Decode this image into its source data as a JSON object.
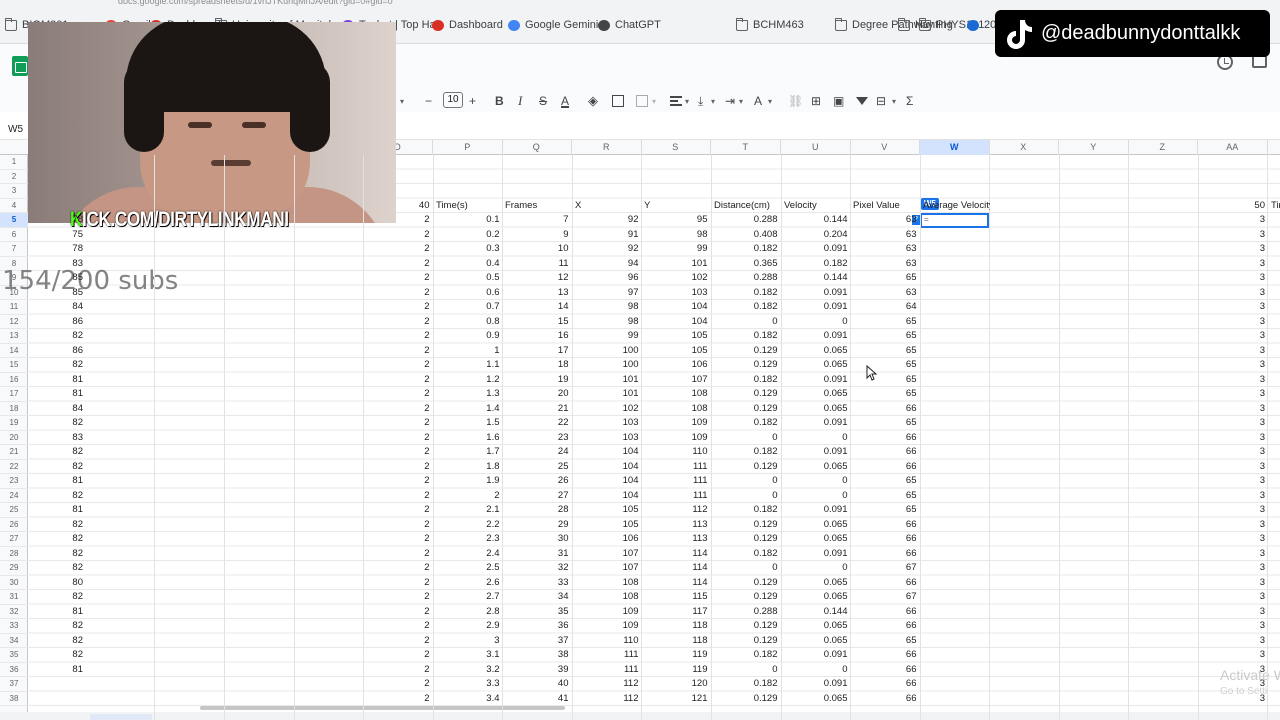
{
  "browser": {
    "bookmarks": [
      {
        "label": "BIOM301",
        "icon": "folder-icon"
      },
      {
        "label": "Gmail",
        "icon": "gmail-icon"
      },
      {
        "label": "Dashboard",
        "icon": "dashboard-icon"
      },
      {
        "label": "University of Manitoba",
        "icon": "folder-icon"
      },
      {
        "label": "Tophat | Top Hat",
        "icon": "tophat-icon"
      },
      {
        "label": "Dashboard",
        "icon": "dashboard-icon"
      },
      {
        "label": "Google Gemini",
        "icon": "gemini-icon"
      },
      {
        "label": "ChatGPT",
        "icon": "chatgpt-icon"
      },
      {
        "label": "BCHM463",
        "icon": "folder-icon"
      },
      {
        "label": "Degree Pathway",
        "icon": "folder-icon"
      },
      {
        "label": "Hunting",
        "icon": "folder-icon"
      },
      {
        "label": "PHYS131",
        "icon": "folder-icon"
      },
      {
        "label": "20",
        "icon": "bmw-icon"
      }
    ],
    "url": "docs.google.com/spreadsheets/d/1vhJTKuhqMhJA/edit?gid=0#gid=0"
  },
  "sheet": {
    "name_box": "W5",
    "font_size": "10",
    "toolbar_icons": [
      "minus-icon",
      "plus-icon",
      "bold-icon",
      "italic-icon",
      "strikethrough-icon",
      "text-color-icon",
      "fill-color-icon",
      "borders-icon",
      "merge-icon",
      "align-icon",
      "valign-icon",
      "wrap-icon",
      "rotate-icon",
      "link-icon",
      "comment-icon",
      "chart-icon",
      "filter-icon",
      "views-icon",
      "functions-icon"
    ],
    "toolbar_labels": {
      "bold": "B",
      "italic": "I",
      "strike": "S",
      "textcolor": "A",
      "rotate": "A",
      "sigma": "Σ",
      "minus": "−",
      "plus": "+"
    },
    "columns": [
      "O",
      "P",
      "Q",
      "R",
      "S",
      "T",
      "U",
      "V",
      "W",
      "X",
      "Y",
      "Z",
      "AA"
    ],
    "selected_column": "W",
    "selected_cell": "W5",
    "selected_cell_chip": "W5",
    "selected_cell_value": "=",
    "formula_hint": "?",
    "row_numbers": [
      "1",
      "2",
      "3",
      "4",
      "5",
      "6",
      "7",
      "8",
      "9",
      "10",
      "11",
      "12",
      "13",
      "14",
      "15",
      "16",
      "17",
      "18",
      "19",
      "20",
      "21",
      "22",
      "23",
      "24",
      "25",
      "26",
      "27",
      "28",
      "29",
      "30",
      "31",
      "32",
      "33",
      "34",
      "35",
      "36",
      "37",
      "38"
    ],
    "header_row": {
      "o": "40",
      "p": "Time(s)",
      "q": "Frames",
      "r": "X",
      "s": "Y",
      "t": "Distance(cm)",
      "u": "Velocity",
      "v": "Pixel Value",
      "w": "Average Velocity",
      "aa_num": "50",
      "aa_text": "Tir"
    },
    "left_col_values": [
      "",
      "",
      "",
      "",
      "78",
      "75",
      "78",
      "83",
      "85",
      "85",
      "84",
      "86",
      "82",
      "86",
      "82",
      "81",
      "81",
      "84",
      "82",
      "83",
      "82",
      "82",
      "81",
      "82",
      "81",
      "82",
      "82",
      "82",
      "82",
      "80",
      "82",
      "81",
      "82",
      "82",
      "82",
      "81"
    ],
    "rows": [
      {
        "o": "2",
        "p": "0.1",
        "q": "7",
        "r": "92",
        "s": "95",
        "t": "0.288",
        "u": "0.144",
        "v": "63",
        "aa": "3"
      },
      {
        "o": "2",
        "p": "0.2",
        "q": "9",
        "r": "91",
        "s": "98",
        "t": "0.408",
        "u": "0.204",
        "v": "63",
        "aa": "3"
      },
      {
        "o": "2",
        "p": "0.3",
        "q": "10",
        "r": "92",
        "s": "99",
        "t": "0.182",
        "u": "0.091",
        "v": "63",
        "aa": "3"
      },
      {
        "o": "2",
        "p": "0.4",
        "q": "11",
        "r": "94",
        "s": "101",
        "t": "0.365",
        "u": "0.182",
        "v": "63",
        "aa": "3"
      },
      {
        "o": "2",
        "p": "0.5",
        "q": "12",
        "r": "96",
        "s": "102",
        "t": "0.288",
        "u": "0.144",
        "v": "65",
        "aa": "3"
      },
      {
        "o": "2",
        "p": "0.6",
        "q": "13",
        "r": "97",
        "s": "103",
        "t": "0.182",
        "u": "0.091",
        "v": "63",
        "aa": "3"
      },
      {
        "o": "2",
        "p": "0.7",
        "q": "14",
        "r": "98",
        "s": "104",
        "t": "0.182",
        "u": "0.091",
        "v": "64",
        "aa": "3"
      },
      {
        "o": "2",
        "p": "0.8",
        "q": "15",
        "r": "98",
        "s": "104",
        "t": "0",
        "u": "0",
        "v": "65",
        "aa": "3"
      },
      {
        "o": "2",
        "p": "0.9",
        "q": "16",
        "r": "99",
        "s": "105",
        "t": "0.182",
        "u": "0.091",
        "v": "65",
        "aa": "3"
      },
      {
        "o": "2",
        "p": "1",
        "q": "17",
        "r": "100",
        "s": "105",
        "t": "0.129",
        "u": "0.065",
        "v": "65",
        "aa": "3"
      },
      {
        "o": "2",
        "p": "1.1",
        "q": "18",
        "r": "100",
        "s": "106",
        "t": "0.129",
        "u": "0.065",
        "v": "65",
        "aa": "3"
      },
      {
        "o": "2",
        "p": "1.2",
        "q": "19",
        "r": "101",
        "s": "107",
        "t": "0.182",
        "u": "0.091",
        "v": "65",
        "aa": "3"
      },
      {
        "o": "2",
        "p": "1.3",
        "q": "20",
        "r": "101",
        "s": "108",
        "t": "0.129",
        "u": "0.065",
        "v": "65",
        "aa": "3"
      },
      {
        "o": "2",
        "p": "1.4",
        "q": "21",
        "r": "102",
        "s": "108",
        "t": "0.129",
        "u": "0.065",
        "v": "66",
        "aa": "3"
      },
      {
        "o": "2",
        "p": "1.5",
        "q": "22",
        "r": "103",
        "s": "109",
        "t": "0.182",
        "u": "0.091",
        "v": "65",
        "aa": "3"
      },
      {
        "o": "2",
        "p": "1.6",
        "q": "23",
        "r": "103",
        "s": "109",
        "t": "0",
        "u": "0",
        "v": "66",
        "aa": "3"
      },
      {
        "o": "2",
        "p": "1.7",
        "q": "24",
        "r": "104",
        "s": "110",
        "t": "0.182",
        "u": "0.091",
        "v": "66",
        "aa": "3"
      },
      {
        "o": "2",
        "p": "1.8",
        "q": "25",
        "r": "104",
        "s": "111",
        "t": "0.129",
        "u": "0.065",
        "v": "66",
        "aa": "3"
      },
      {
        "o": "2",
        "p": "1.9",
        "q": "26",
        "r": "104",
        "s": "111",
        "t": "0",
        "u": "0",
        "v": "65",
        "aa": "3"
      },
      {
        "o": "2",
        "p": "2",
        "q": "27",
        "r": "104",
        "s": "111",
        "t": "0",
        "u": "0",
        "v": "65",
        "aa": "3"
      },
      {
        "o": "2",
        "p": "2.1",
        "q": "28",
        "r": "105",
        "s": "112",
        "t": "0.182",
        "u": "0.091",
        "v": "65",
        "aa": "3"
      },
      {
        "o": "2",
        "p": "2.2",
        "q": "29",
        "r": "105",
        "s": "113",
        "t": "0.129",
        "u": "0.065",
        "v": "66",
        "aa": "3"
      },
      {
        "o": "2",
        "p": "2.3",
        "q": "30",
        "r": "106",
        "s": "113",
        "t": "0.129",
        "u": "0.065",
        "v": "66",
        "aa": "3"
      },
      {
        "o": "2",
        "p": "2.4",
        "q": "31",
        "r": "107",
        "s": "114",
        "t": "0.182",
        "u": "0.091",
        "v": "66",
        "aa": "3"
      },
      {
        "o": "2",
        "p": "2.5",
        "q": "32",
        "r": "107",
        "s": "114",
        "t": "0",
        "u": "0",
        "v": "67",
        "aa": "3"
      },
      {
        "o": "2",
        "p": "2.6",
        "q": "33",
        "r": "108",
        "s": "114",
        "t": "0.129",
        "u": "0.065",
        "v": "66",
        "aa": "3"
      },
      {
        "o": "2",
        "p": "2.7",
        "q": "34",
        "r": "108",
        "s": "115",
        "t": "0.129",
        "u": "0.065",
        "v": "67",
        "aa": "3"
      },
      {
        "o": "2",
        "p": "2.8",
        "q": "35",
        "r": "109",
        "s": "117",
        "t": "0.288",
        "u": "0.144",
        "v": "66",
        "aa": "3"
      },
      {
        "o": "2",
        "p": "2.9",
        "q": "36",
        "r": "109",
        "s": "118",
        "t": "0.129",
        "u": "0.065",
        "v": "66",
        "aa": "3"
      },
      {
        "o": "2",
        "p": "3",
        "q": "37",
        "r": "110",
        "s": "118",
        "t": "0.129",
        "u": "0.065",
        "v": "65",
        "aa": "3"
      },
      {
        "o": "2",
        "p": "3.1",
        "q": "38",
        "r": "111",
        "s": "119",
        "t": "0.182",
        "u": "0.091",
        "v": "66",
        "aa": "3"
      },
      {
        "o": "2",
        "p": "3.2",
        "q": "39",
        "r": "111",
        "s": "119",
        "t": "0",
        "u": "0",
        "v": "66",
        "aa": "3"
      },
      {
        "o": "2",
        "p": "3.3",
        "q": "40",
        "r": "112",
        "s": "120",
        "t": "0.182",
        "u": "0.091",
        "v": "66",
        "aa": "3"
      },
      {
        "o": "2",
        "p": "3.4",
        "q": "41",
        "r": "112",
        "s": "121",
        "t": "0.129",
        "u": "0.065",
        "v": "66",
        "aa": "3"
      }
    ]
  },
  "overlays": {
    "kick_prefix": "K",
    "kick_rest": "ICK.COM/DIRTYLINKMANI",
    "subs": "154/200 subs",
    "tiktok_handle": "@deadbunnydonttalkk",
    "activate": "Activate W",
    "goto": "Go to Setti"
  },
  "colors": {
    "accent": "#1a73e8",
    "sheets_green": "#0f9d58",
    "kick_green": "#53fc18"
  }
}
